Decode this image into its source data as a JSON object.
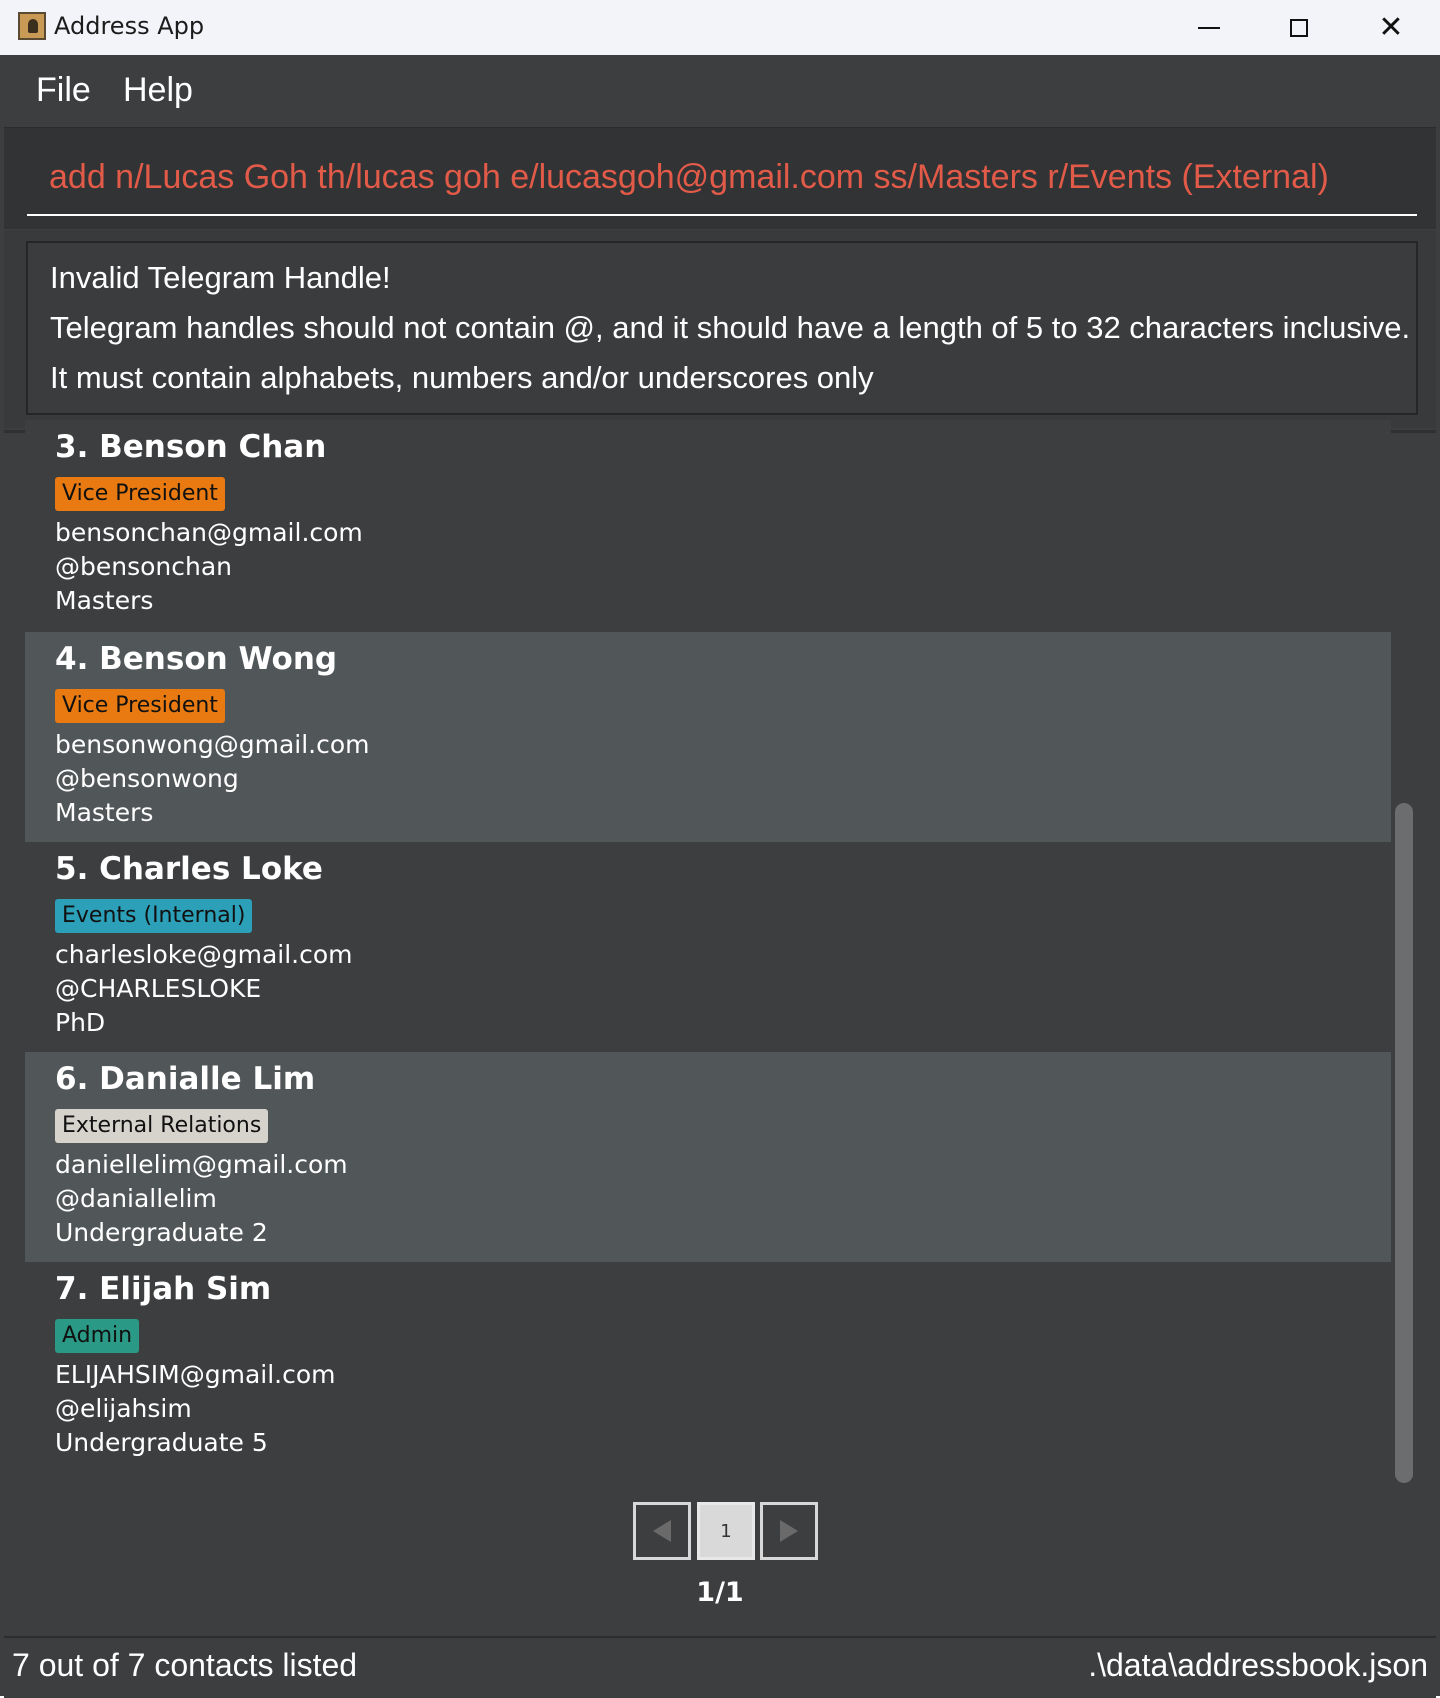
{
  "window": {
    "title": "Address App",
    "icon": "address-book-icon"
  },
  "menu": {
    "items": [
      {
        "label": "File"
      },
      {
        "label": "Help"
      }
    ]
  },
  "command": {
    "value": "add n/Lucas Goh th/lucas goh e/lucasgoh@gmail.com ss/Masters r/Events (External)",
    "text_color": "#e25a48"
  },
  "result": {
    "lines": [
      "Invalid Telegram Handle!",
      "Telegram handles should not contain @, and it should have a length of 5 to 32 characters inclusive.",
      "It must contain alphabets, numbers and/or underscores only"
    ]
  },
  "persons": [
    {
      "name": "3. Benson Chan",
      "role": "Vice President",
      "role_color": "#e87a11",
      "email": "bensonchan@gmail.com",
      "telegram": "@bensonchan",
      "study": "Masters"
    },
    {
      "name": "4. Benson Wong",
      "role": "Vice President",
      "role_color": "#e87a11",
      "email": "bensonwong@gmail.com",
      "telegram": "@bensonwong",
      "study": "Masters"
    },
    {
      "name": "5. Charles Loke",
      "role": "Events (Internal)",
      "role_color": "#2ba0b8",
      "email": "charlesloke@gmail.com",
      "telegram": "@CHARLESLOKE",
      "study": "PhD"
    },
    {
      "name": "6. Danialle Lim",
      "role": "External Relations",
      "role_color": "#d5d3cc",
      "email": "daniellelim@gmail.com",
      "telegram": "@daniallelim",
      "study": "Undergraduate 2"
    },
    {
      "name": "7. Elijah Sim",
      "role": "Admin",
      "role_color": "#2a9a86",
      "email": "ELIJAHSIM@gmail.com",
      "telegram": "@elijahsim",
      "study": "Undergraduate 5"
    }
  ],
  "pagination": {
    "current_page": "1",
    "page_label": "1/1"
  },
  "status": {
    "left": "7 out of 7 contacts listed",
    "right": ".\\data\\addressbook.json"
  }
}
